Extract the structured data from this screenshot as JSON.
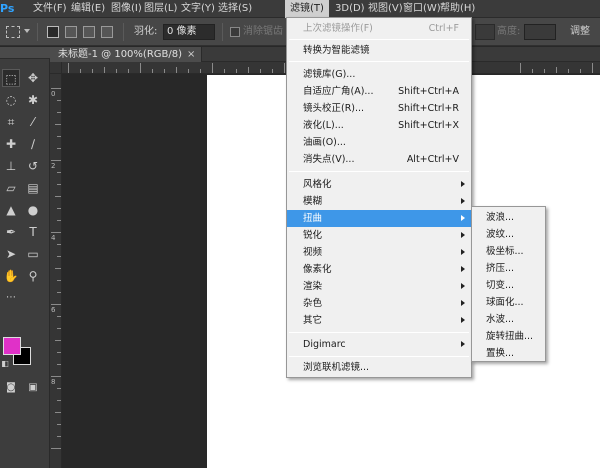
{
  "app": {
    "logo": "Ps",
    "accent_color": "#30a3ff"
  },
  "menubar": {
    "items": [
      "文件(F)",
      "编辑(E)",
      "图像(I)",
      "图层(L)",
      "文字(Y)",
      "选择(S)",
      "滤镜(T)",
      "3D(D)",
      "视图(V)",
      "窗口(W)",
      "帮助(H)"
    ],
    "active": "滤镜(T)"
  },
  "options_bar": {
    "feather_label": "羽化:",
    "feather_value": "0 像素",
    "antialias_label": "消除锯齿",
    "height_label": "高度:",
    "adjust_label": "调整",
    "tool_icon": "marquee-icon"
  },
  "document": {
    "tab_label": "未标题-1 @ 100%(RGB/8)",
    "close_symbol": "×",
    "ruler_numbers": [
      "0",
      "2",
      "4",
      "6",
      "8"
    ]
  },
  "toolbox": {
    "tools": [
      "move-icon",
      "rect-marquee-icon",
      "lasso-icon",
      "quick-select-icon",
      "crop-icon",
      "eyedropper-icon",
      "healing-icon",
      "brush-icon",
      "clone-stamp-icon",
      "history-brush-icon",
      "eraser-icon",
      "gradient-icon",
      "blur-icon",
      "dodge-icon",
      "pen-icon",
      "type-icon",
      "path-select-icon",
      "shape-icon",
      "hand-icon",
      "zoom-icon"
    ],
    "foreground_color": "#e031c8",
    "background_color": "#000000"
  },
  "filter_menu": {
    "last_filter": {
      "label": "上次滤镜操作(F)",
      "shortcut": "Ctrl+F"
    },
    "smart": "转换为智能滤镜",
    "group1": [
      {
        "label": "滤镜库(G)...",
        "shortcut": ""
      },
      {
        "label": "自适应广角(A)...",
        "shortcut": "Shift+Ctrl+A"
      },
      {
        "label": "镜头校正(R)...",
        "shortcut": "Shift+Ctrl+R"
      },
      {
        "label": "液化(L)...",
        "shortcut": "Shift+Ctrl+X"
      },
      {
        "label": "油画(O)...",
        "shortcut": ""
      },
      {
        "label": "消失点(V)...",
        "shortcut": "Alt+Ctrl+V"
      }
    ],
    "group2": [
      "风格化",
      "模糊",
      "扭曲",
      "锐化",
      "视频",
      "像素化",
      "渲染",
      "杂色",
      "其它"
    ],
    "highlighted": "扭曲",
    "digimarc": "Digimarc",
    "browse": "浏览联机滤镜..."
  },
  "distort_submenu": [
    "波浪...",
    "波纹...",
    "极坐标...",
    "挤压...",
    "切变...",
    "球面化...",
    "水波...",
    "旋转扭曲...",
    "置换..."
  ]
}
